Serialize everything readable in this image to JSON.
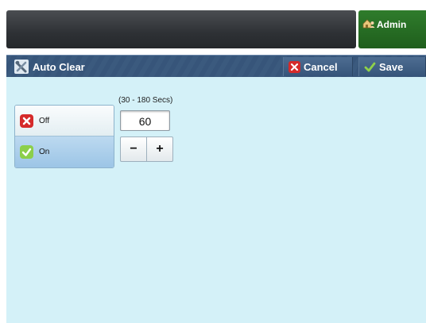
{
  "topbar": {
    "admin_label": "Admin"
  },
  "header": {
    "title": "Auto Clear",
    "cancel_label": "Cancel",
    "save_label": "Save"
  },
  "options": [
    {
      "label": "Off",
      "selected": false
    },
    {
      "label": "On",
      "selected": true
    }
  ],
  "timer": {
    "range_label": "(30 - 180 Secs)",
    "value": "60",
    "decrement_label": "−",
    "increment_label": "+"
  },
  "colors": {
    "header_bg": "#3b5a7e",
    "content_bg": "#d4f1f8",
    "admin_bg": "#2f7c2c",
    "selected_option": "#9cc5e6"
  }
}
